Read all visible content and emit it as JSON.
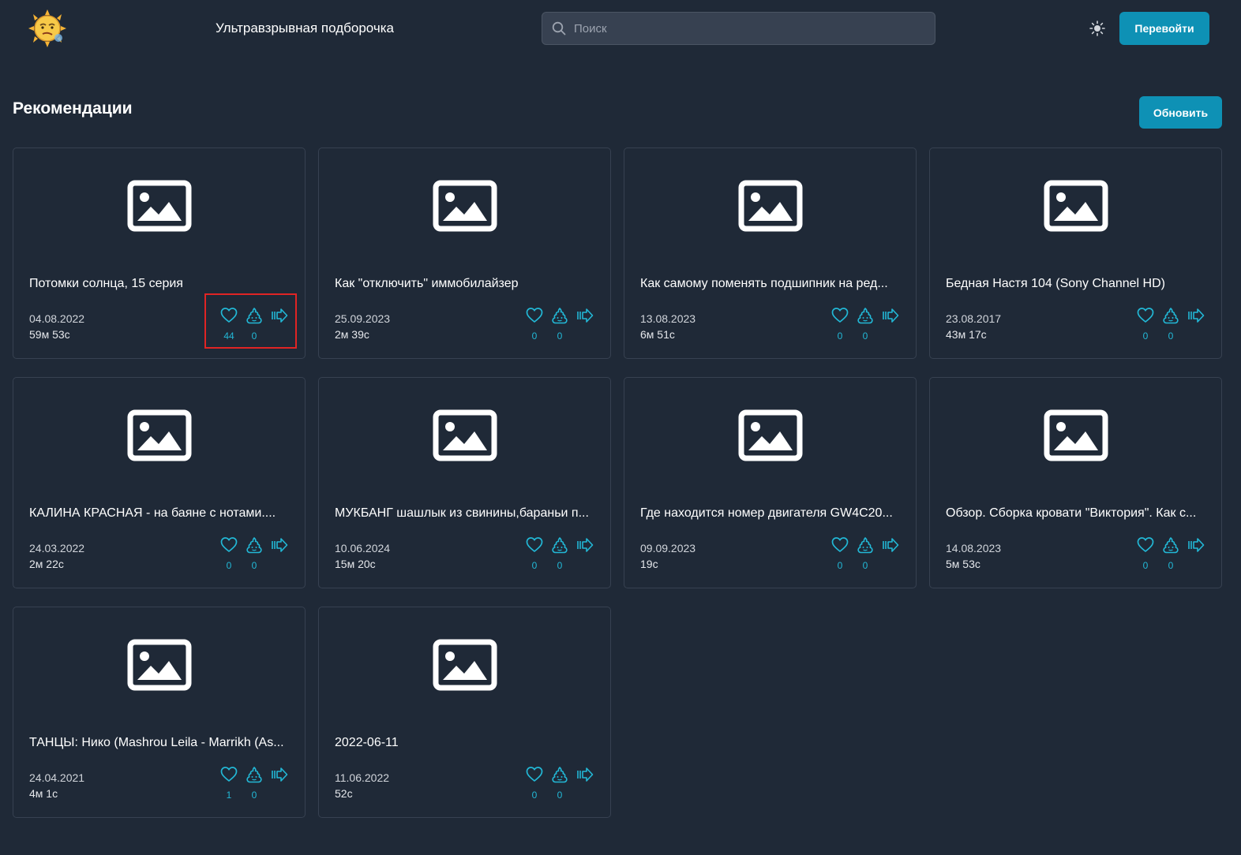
{
  "header": {
    "title": "Ультравзрывная подборочка",
    "search_placeholder": "Поиск",
    "search_value": "",
    "go_label": "Перевойти"
  },
  "section": {
    "title": "Рекомендации",
    "refresh_label": "Обновить"
  },
  "colors": {
    "background": "#1f2937",
    "accent": "#0e91b5",
    "icon_accent": "#22b8d6",
    "highlight": "#e02424"
  },
  "icons": {
    "logo": "sun-face-logo",
    "search": "search-icon",
    "theme": "sun-icon",
    "thumbnail": "image-placeholder-icon",
    "like": "heart-icon",
    "dislike": "poop-icon",
    "share": "share-icon"
  },
  "videos": [
    {
      "title": "Потомки солнца, 15 серия",
      "date": "04.08.2022",
      "duration": "59м 53с",
      "likes": "44",
      "dislikes": "0"
    },
    {
      "title": "Как \"отключить\" иммобилайзер",
      "date": "25.09.2023",
      "duration": "2м 39с",
      "likes": "0",
      "dislikes": "0"
    },
    {
      "title": "Как самому поменять подшипник на ред...",
      "date": "13.08.2023",
      "duration": "6м 51с",
      "likes": "0",
      "dislikes": "0"
    },
    {
      "title": "Бедная Настя 104 (Sony Channel HD)",
      "date": "23.08.2017",
      "duration": "43м 17с",
      "likes": "0",
      "dislikes": "0"
    },
    {
      "title": "КАЛИНА КРАСНАЯ - на баяне с нотами....",
      "date": "24.03.2022",
      "duration": "2м 22с",
      "likes": "0",
      "dislikes": "0"
    },
    {
      "title": "МУКБАНГ шашлык из свинины,бараньи п...",
      "date": "10.06.2024",
      "duration": "15м 20с",
      "likes": "0",
      "dislikes": "0"
    },
    {
      "title": "Где находится номер двигателя GW4C20...",
      "date": "09.09.2023",
      "duration": "19с",
      "likes": "0",
      "dislikes": "0"
    },
    {
      "title": "Обзор. Сборка кровати \"Виктория\". Как с...",
      "date": "14.08.2023",
      "duration": "5м 53с",
      "likes": "0",
      "dislikes": "0"
    },
    {
      "title": "ТАНЦЫ: Нико (Mashrou Leila - Marrikh (As...",
      "date": "24.04.2021",
      "duration": "4м 1с",
      "likes": "1",
      "dislikes": "0"
    },
    {
      "title": "2022-06-11",
      "date": "11.06.2022",
      "duration": "52с",
      "likes": "0",
      "dislikes": "0"
    }
  ]
}
